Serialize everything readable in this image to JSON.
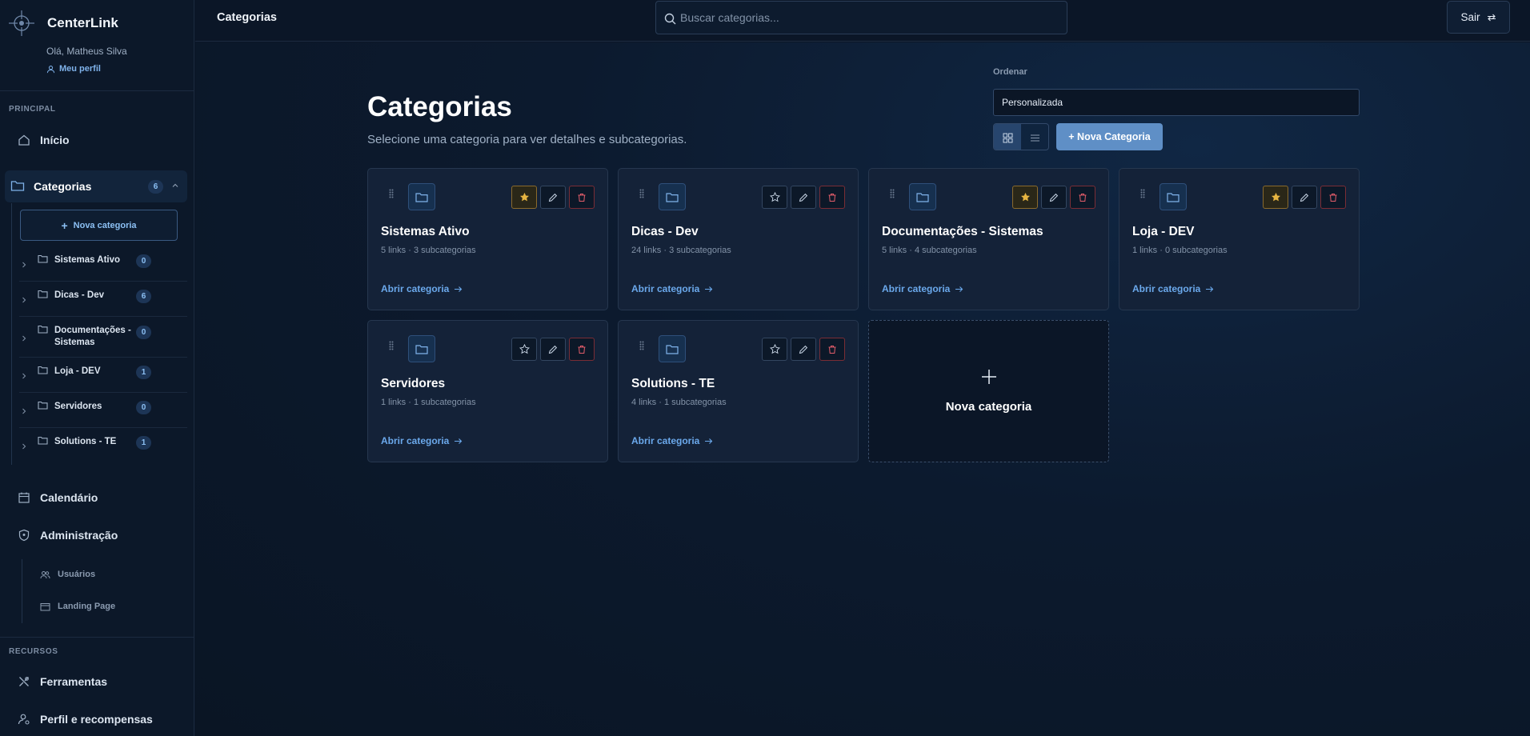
{
  "app": {
    "name": "CenterLink",
    "greeting": "Olá, Matheus Silva",
    "profile_link": "Meu perfil"
  },
  "sidebar": {
    "section_principal": "PRINCIPAL",
    "section_recursos": "RECURSOS",
    "inicio": "Início",
    "categorias": {
      "label": "Categorias",
      "count": "6"
    },
    "new_category": "Nova categoria",
    "subcategories": [
      {
        "label": "Sistemas Ativo",
        "count": "0"
      },
      {
        "label": "Dicas - Dev",
        "count": "6"
      },
      {
        "label": "Documentações - Sistemas",
        "count": "0"
      },
      {
        "label": "Loja - DEV",
        "count": "1"
      },
      {
        "label": "Servidores",
        "count": "0"
      },
      {
        "label": "Solutions - TE",
        "count": "1"
      }
    ],
    "calendario": "Calendário",
    "administracao": "Administração",
    "usuarios": "Usuários",
    "landing_page": "Landing Page",
    "ferramentas": "Ferramentas",
    "perfil_recompensas": "Perfil e recompensas"
  },
  "topbar": {
    "title": "Categorias",
    "search_placeholder": "Buscar categorias...",
    "logout": "Sair"
  },
  "main": {
    "title": "Categorias",
    "subtitle": "Selecione uma categoria para ver detalhes e subcategorias.",
    "order_label": "Ordenar",
    "order_value": "Personalizada",
    "new_category_button": "+ Nova Categoria",
    "open_label": "Abrir categoria",
    "new_card_label": "Nova categoria",
    "cards": [
      {
        "name": "Sistemas Ativo",
        "meta": "5 links · 3 subcategorias",
        "favorite": true
      },
      {
        "name": "Dicas - Dev",
        "meta": "24 links · 3 subcategorias",
        "favorite": false
      },
      {
        "name": "Documentações - Sistemas",
        "meta": "5 links · 4 subcategorias",
        "favorite": true
      },
      {
        "name": "Loja - DEV",
        "meta": "1 links · 0 subcategorias",
        "favorite": true
      },
      {
        "name": "Servidores",
        "meta": "1 links · 1 subcategorias",
        "favorite": false
      },
      {
        "name": "Solutions - TE",
        "meta": "4 links · 1 subcategorias",
        "favorite": false
      }
    ]
  },
  "colors": {
    "accent": "#5f8fc6",
    "link": "#6ba9ec",
    "star": "#e6b441",
    "danger": "#e35d6a",
    "background": "#0b1627"
  }
}
